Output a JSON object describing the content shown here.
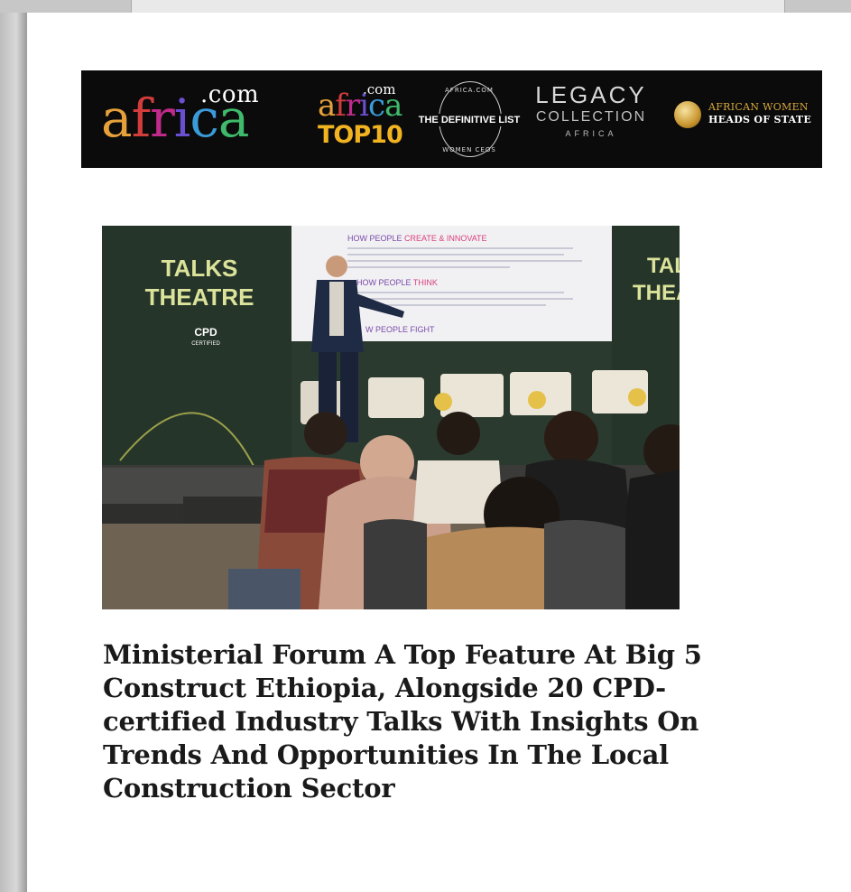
{
  "banner": {
    "africa_logo": {
      "dotcom": ".com",
      "letters": [
        "a",
        "f",
        "r",
        "i",
        "c",
        "a"
      ]
    },
    "top10_logo": {
      "dotcom": ".com",
      "word": "africa",
      "top10": "TOP10"
    },
    "definitive_list": {
      "text": "THE DEFINITIVE LIST",
      "ring_top": "AFRICA.COM",
      "ring_bottom": "WOMEN CEOS"
    },
    "legacy_logo": {
      "line1": "LEGACY",
      "line2": "COLLECTION",
      "line3": "AFRICA"
    },
    "awhs_logo": {
      "line1": "AFRICAN WOMEN",
      "line2": "HEADS OF STATE"
    },
    "colors": {
      "background": "#0b0b0b",
      "gold": "#f2b321"
    }
  },
  "photo": {
    "left_panel": {
      "line1": "TALKS",
      "line2": "THEATRE",
      "badge": "CPD",
      "badge_sub": "CERTIFIED"
    },
    "right_panel": {
      "line1": "TAL",
      "line2": "THEA"
    },
    "slide": {
      "heading1_prefix": "HOW PEOPLE",
      "heading1_accent": "CREATE & INNOVATE",
      "heading2_prefix": "HOW PEOPLE",
      "heading2_accent": "THINK",
      "heading3": "W PEOPLE FIGHT"
    },
    "colors": {
      "panel_green": "#26352a",
      "panel_text": "#dbe39a",
      "accent_pink": "#d9407a"
    }
  },
  "article": {
    "headline_lines": [
      "Ministerial Forum A Top Feature At Big 5",
      "Construct Ethiopia, Alongside 20 CPD-",
      "certified Industry Talks With Insights On",
      "Trends And Opportunities In The Local",
      "Construction Sector"
    ]
  }
}
